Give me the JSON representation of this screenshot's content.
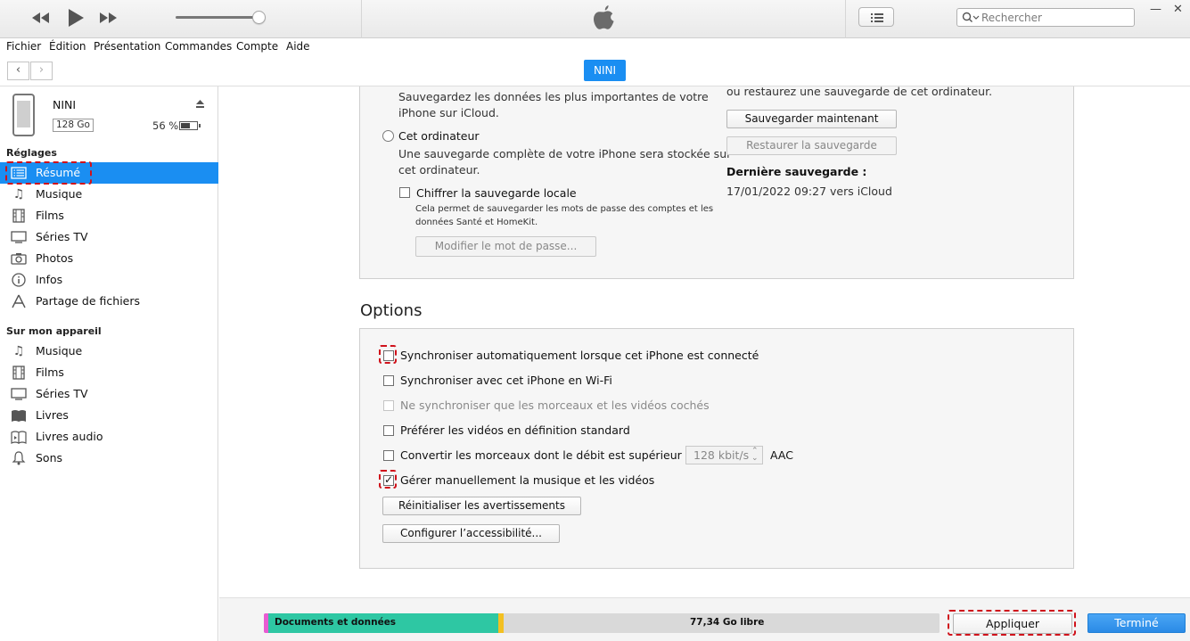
{
  "menu": [
    "Fichier",
    "Édition",
    "Présentation",
    "Commandes",
    "Compte",
    "Aide"
  ],
  "search": {
    "placeholder": "Rechercher"
  },
  "device_tab": "NINI",
  "device": {
    "name": "NINI",
    "capacity": "128 Go",
    "battery": "56 %",
    "battery_level": 0.56
  },
  "sidebar": {
    "section1": "Réglages",
    "items1": [
      {
        "label": "Résumé",
        "icon": "summary-icon"
      },
      {
        "label": "Musique",
        "icon": "music-note-icon"
      },
      {
        "label": "Films",
        "icon": "film-icon"
      },
      {
        "label": "Séries TV",
        "icon": "tv-icon"
      },
      {
        "label": "Photos",
        "icon": "camera-icon"
      },
      {
        "label": "Infos",
        "icon": "info-icon"
      },
      {
        "label": "Partage de fichiers",
        "icon": "apps-icon"
      }
    ],
    "section2": "Sur mon appareil",
    "items2": [
      {
        "label": "Musique",
        "icon": "music-note-icon"
      },
      {
        "label": "Films",
        "icon": "film-icon"
      },
      {
        "label": "Séries TV",
        "icon": "tv-icon"
      },
      {
        "label": "Livres",
        "icon": "book-icon"
      },
      {
        "label": "Livres audio",
        "icon": "audiobook-icon"
      },
      {
        "label": "Sons",
        "icon": "bell-icon"
      }
    ]
  },
  "backup": {
    "icloud_desc_1": "Sauvegardez les données les plus importantes de votre",
    "icloud_desc_2": "iPhone sur iCloud.",
    "computer_label": "Cet ordinateur",
    "computer_desc_1": "Une sauvegarde complète de votre iPhone sera stockée sur",
    "computer_desc_2": "cet ordinateur.",
    "encrypt_label": "Chiffrer la sauvegarde locale",
    "encrypt_desc_1": "Cela permet de sauvegarder les mots de passe des comptes et les",
    "encrypt_desc_2": "données Santé et HomeKit.",
    "change_password": "Modifier le mot de passe...",
    "restore_text": "ou restaurez une sauvegarde de cet ordinateur.",
    "backup_now": "Sauvegarder maintenant",
    "restore_backup": "Restaurer la sauvegarde",
    "last_backup_label": "Dernière sauvegarde :",
    "last_backup_value": "17/01/2022 09:27 vers iCloud"
  },
  "options": {
    "title": "Options",
    "auto_sync": "Synchroniser automatiquement lorsque cet iPhone est connecté",
    "wifi_sync": "Synchroniser avec cet iPhone en Wi-Fi",
    "only_checked": "Ne synchroniser que les morceaux et les vidéos cochés",
    "prefer_sd": "Préférer les vidéos en définition standard",
    "convert": "Convertir les morceaux dont le débit est supérieur en",
    "bitrate": "128 kbit/s",
    "aac": "AAC",
    "manual": "Gérer manuellement la musique et les vidéos",
    "reset_warnings": "Réinitialiser les avertissements",
    "accessibility": "Configurer l’accessibilité..."
  },
  "storage": {
    "docs_label": "Documents et données",
    "free_label": "77,34 Go libre",
    "colors": {
      "pink": "#e85bd2",
      "teal": "#2ec7a3",
      "yellow": "#f3c022",
      "free": "#d9d9d9"
    }
  },
  "footer": {
    "apply": "Appliquer",
    "done": "Terminé"
  },
  "accent": "#1a8ef2",
  "highlight": "#d0121b"
}
